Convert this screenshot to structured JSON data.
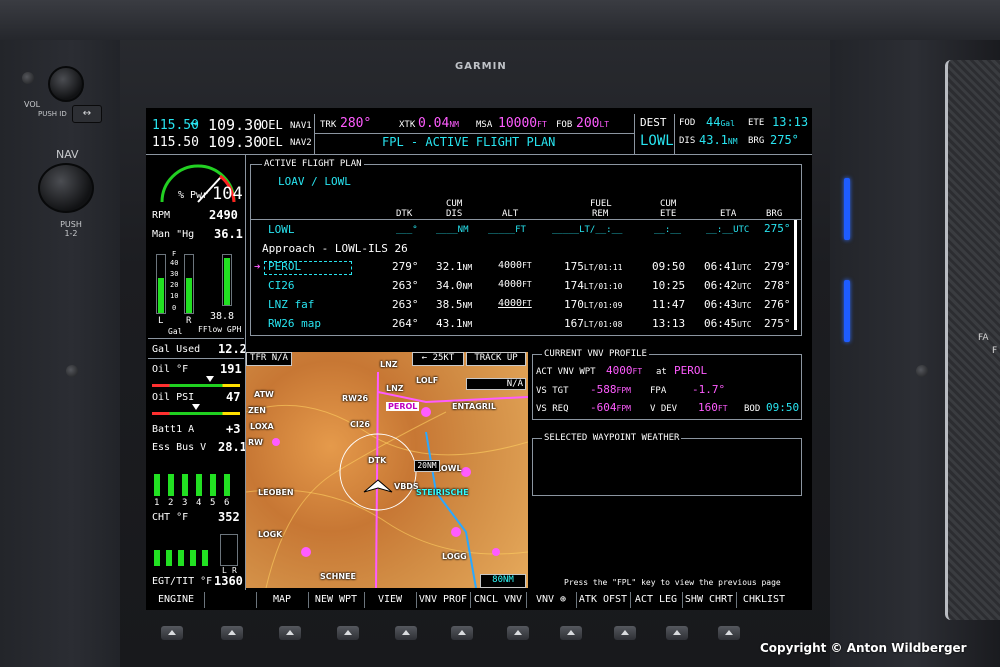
{
  "bezel": {
    "brand": "GARMIN",
    "vol_label": "VOL",
    "push_id_label": "PUSH ID",
    "nav_label": "NAV",
    "push_12_label": "PUSH 1-2",
    "swap_icon": "↔",
    "copyright": "Copyright © Anton Wildberger",
    "right_edge_label": "FA",
    "right_edge_label2": "F"
  },
  "nav_radios": {
    "nav1_standby": "115.50",
    "nav1_swap_icon": "↔",
    "nav1_active": "109.30",
    "nav1_ident": "OEL",
    "nav1_label": "NAV1",
    "nav2_standby": "115.50",
    "nav2_active": "109.30",
    "nav2_ident": "OEL",
    "nav2_label": "NAV2"
  },
  "data_bar": {
    "trk_label": "TRK",
    "trk_value": "280°",
    "xtk_label": "XTK",
    "xtk_value": "0.04",
    "xtk_unit": "NM",
    "msa_label": "MSA",
    "msa_value": "10000",
    "msa_unit": "FT",
    "fob_label": "FOB",
    "fob_value": "200",
    "fob_unit": "LT",
    "page_title": "FPL - ACTIVE FLIGHT PLAN",
    "dest_label": "DEST",
    "dest_value": "LOWL",
    "fod_label": "FOD",
    "fod_value": "44",
    "fod_unit": "Gal",
    "ete_label": "ETE",
    "ete_value": "13:13",
    "dis_label": "DIS",
    "dis_value": "43.1",
    "dis_unit": "NM",
    "brg_label": "BRG",
    "brg_value": "275°"
  },
  "engine": {
    "pwr_label": "% Pwr",
    "pwr_value": "104",
    "rpm_label": "RPM",
    "rpm_value": "2490",
    "man_label": "Man \"Hg",
    "man_value": "36.1",
    "fuel_f": "F",
    "fuel_40": "40",
    "fuel_30": "30",
    "fuel_20": "20",
    "fuel_10": "10",
    "fuel_0": "0",
    "fuel_l": "L",
    "fuel_r": "R",
    "fuel_gal": "Gal",
    "fflow_value": "38.8",
    "fflow_label": "FFlow GPH",
    "gal_used_label": "Gal Used",
    "gal_used_value": "12.2",
    "oil_temp_label": "Oil °F",
    "oil_temp_value": "191",
    "oil_psi_label": "Oil PSI",
    "oil_psi_value": "47",
    "batt_label": "Batt1 A",
    "batt_value": "+3",
    "ess_bus_label": "Ess Bus V",
    "ess_bus_value": "28.1",
    "cyl_numbers": [
      "1",
      "2",
      "3",
      "4",
      "5",
      "6"
    ],
    "cht_label": "CHT °F",
    "cht_value": "352",
    "egt_label": "EGT/TIT °F",
    "egt_value": "1360",
    "egt_l": "L",
    "egt_r": "R"
  },
  "flight_plan": {
    "section_title": "ACTIVE FLIGHT PLAN",
    "route": "LOAV / LOWL",
    "headers": {
      "dtk": "DTK",
      "cum_dis_1": "CUM",
      "cum_dis_2": "DIS",
      "alt": "ALT",
      "fuel_rem_1": "FUEL",
      "fuel_rem_2": "REM",
      "cum_ete_1": "CUM",
      "cum_ete_2": "ETE",
      "eta": "ETA",
      "brg": "BRG"
    },
    "first_row": {
      "wpt": "LOWL",
      "dtk": "___°",
      "dis": "____NM",
      "alt": "_____FT",
      "fuel": "_____LT/__:__",
      "ete": "__:__",
      "eta": "__:__UTC",
      "brg": "275°"
    },
    "approach": "Approach - LOWL-ILS 26",
    "active_leg_icon": "➔",
    "rows": [
      {
        "wpt": "PEROL",
        "dtk": "279°",
        "dis": "32.1",
        "dis_unit": "NM",
        "alt": "4000",
        "alt_unit": "FT",
        "fuel": "175",
        "fuel_unit": "LT/01:11",
        "ete": "09:50",
        "eta": "06:41",
        "eta_unit": "UTC",
        "brg": "279°"
      },
      {
        "wpt": "CI26",
        "dtk": "263°",
        "dis": "34.0",
        "dis_unit": "NM",
        "alt": "4000",
        "alt_unit": "FT",
        "fuel": "174",
        "fuel_unit": "LT/01:10",
        "ete": "10:25",
        "eta": "06:42",
        "eta_unit": "UTC",
        "brg": "278°"
      },
      {
        "wpt": "LNZ faf",
        "dtk": "263°",
        "dis": "38.5",
        "dis_unit": "NM",
        "alt": "4000",
        "alt_unit": "FT",
        "fuel": "170",
        "fuel_unit": "LT/01:09",
        "ete": "11:47",
        "eta": "06:43",
        "eta_unit": "UTC",
        "brg": "276°"
      },
      {
        "wpt": "RW26 map",
        "dtk": "264°",
        "dis": "43.1",
        "dis_unit": "NM",
        "alt": "",
        "alt_unit": "",
        "fuel": "167",
        "fuel_unit": "LT/01:08",
        "ete": "13:13",
        "eta": "06:45",
        "eta_unit": "UTC",
        "brg": "275°"
      }
    ]
  },
  "map": {
    "tfr": "TFR N/A",
    "wind_arrow": "←",
    "wind_speed": "25KT",
    "orientation": "TRACK UP",
    "na": "N/A",
    "range": "20NM",
    "scale": "80NM",
    "labels": [
      "LNZ",
      "LNZ",
      "LOLF",
      "RW26",
      "PEROL",
      "CI26",
      "ZEN",
      "ATW",
      "ENTAGRIL",
      "LOXA",
      "LOWL",
      "LEOBEN",
      "LOGK",
      "RW",
      "VBDS",
      "STEIRISCHE",
      "SCHNEE",
      "LOGG",
      "DTK"
    ]
  },
  "vnv": {
    "title": "CURRENT VNV PROFILE",
    "act_wpt_label": "ACT VNV WPT",
    "act_wpt_alt": "4000",
    "act_wpt_unit": "FT",
    "at_label": "at",
    "act_wpt_name": "PEROL",
    "vs_tgt_label": "VS TGT",
    "vs_tgt_value": "-588",
    "vs_tgt_unit": "FPM",
    "fpa_label": "FPA",
    "fpa_value": "-1.7°",
    "vs_req_label": "VS REQ",
    "vs_req_value": "-604",
    "vs_req_unit": "FPM",
    "vdev_label": "V DEV",
    "vdev_value": "160",
    "vdev_unit": "FT",
    "bod_label": "BOD",
    "bod_value": "09:50"
  },
  "weather": {
    "title": "SELECTED WAYPOINT WEATHER"
  },
  "footer_hint": "Press the \"FPL\" key to view the previous page",
  "softkeys": [
    "ENGINE",
    "",
    "MAP",
    "NEW WPT",
    "VIEW",
    "VNV PROF",
    "CNCL VNV",
    "VNV ⊕",
    "ATK OFST",
    "ACT LEG",
    "SHW CHRT",
    "CHKLIST"
  ]
}
